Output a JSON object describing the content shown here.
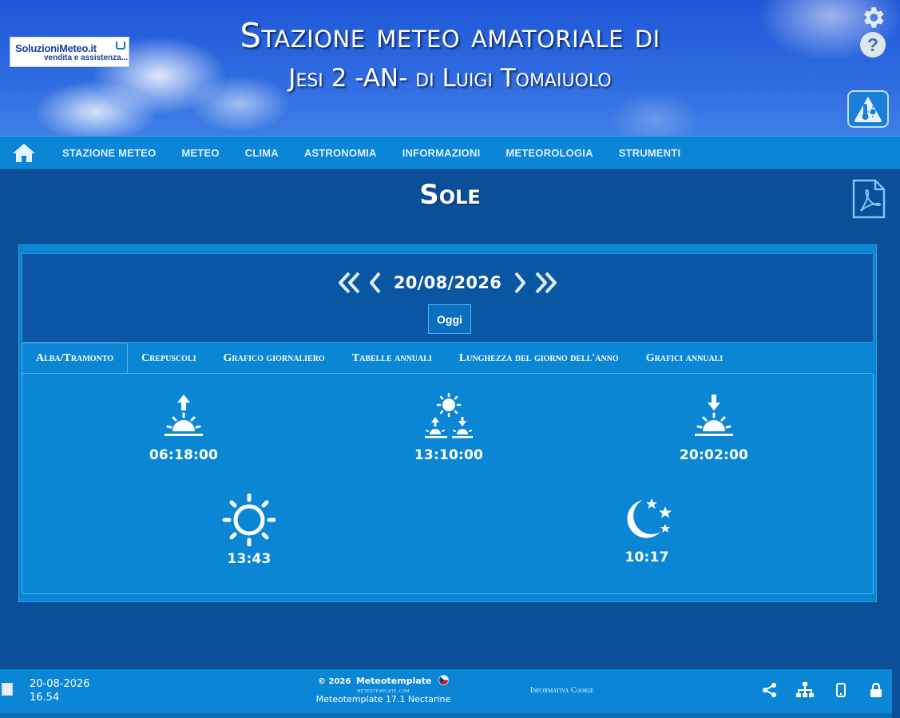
{
  "header": {
    "logo_name": "SoluzioniMeteo.it",
    "logo_sub": "vendita e assistenza...",
    "title_line1": "Stazione meteo amatoriale di",
    "title_line2": "Jesi 2 -AN- di Luigi Tomaiuolo"
  },
  "nav": {
    "items": [
      "STAZIONE METEO",
      "METEO",
      "CLIMA",
      "ASTRONOMIA",
      "INFORMAZIONI",
      "METEOROLOGIA",
      "STRUMENTI"
    ]
  },
  "page": {
    "title": "Sole"
  },
  "date_nav": {
    "date": "20/08/2026",
    "today_label": "Oggi"
  },
  "tabs": [
    "Alba/Tramonto",
    "Crepuscoli",
    "Grafico giornaliero",
    "Tabelle annuali",
    "Lunghezza del giorno dell'anno",
    "Grafici annuali"
  ],
  "sun": {
    "sunrise": "06:18:00",
    "solar_noon": "13:10:00",
    "sunset": "20:02:00",
    "daylight": "13:43",
    "night": "10:17"
  },
  "footer": {
    "date": "20-08-2026",
    "time": "16.54",
    "copyright": "© 2026",
    "brand": "Meteotemplate",
    "site": "meteotemplate.com",
    "version": "Meteotemplate 17.1 Nectarine",
    "cookie": "Informativa Cookie"
  },
  "colors": {
    "background": "#0a4f98",
    "nav": "#0b86d6",
    "panel": "#0a86d4",
    "date_bar": "#0a56a3"
  },
  "icons": [
    "gear-icon",
    "help-icon",
    "theme-icon",
    "home-icon",
    "pdf-icon",
    "sunrise-icon",
    "solar-noon-icon",
    "sunset-icon",
    "sun-icon",
    "moon-icon",
    "share-icon",
    "sitemap-icon",
    "mobile-icon",
    "lock-icon"
  ]
}
